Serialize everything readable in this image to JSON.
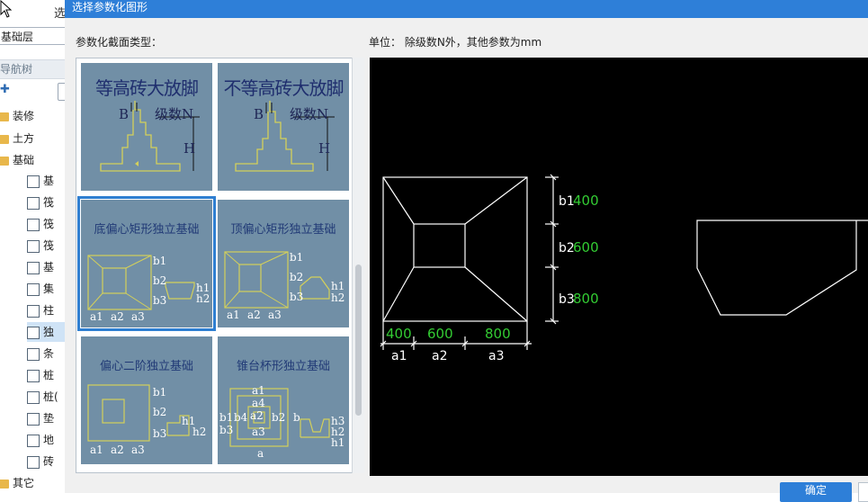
{
  "app": {
    "toolbar_fragment": "选",
    "floor_value": "基础层",
    "nav_title": "导航树",
    "tree": [
      {
        "label": "装修",
        "kind": "folder"
      },
      {
        "label": "土方",
        "kind": "folder"
      },
      {
        "label": "基础",
        "kind": "folder"
      },
      {
        "label": "基",
        "kind": "item",
        "icon": "pencil-icon"
      },
      {
        "label": "筏",
        "kind": "item",
        "icon": "raft-icon"
      },
      {
        "label": "筏",
        "kind": "item",
        "icon": "raft-grid-icon"
      },
      {
        "label": "筏",
        "kind": "item",
        "icon": "raft-opening-icon"
      },
      {
        "label": "基",
        "kind": "item",
        "icon": "beam-icon"
      },
      {
        "label": "集",
        "kind": "item",
        "icon": "sump-icon"
      },
      {
        "label": "柱",
        "kind": "item",
        "icon": "column-pier-icon"
      },
      {
        "label": "独",
        "kind": "item",
        "icon": "isolated-footing-icon"
      },
      {
        "label": "条",
        "kind": "item",
        "icon": "strip-footing-icon"
      },
      {
        "label": "桩",
        "kind": "item",
        "icon": "pile-cap-icon"
      },
      {
        "label": "桩(",
        "kind": "item",
        "icon": "pile-icon"
      },
      {
        "label": "垫",
        "kind": "item",
        "icon": "cushion-icon"
      },
      {
        "label": "地",
        "kind": "item",
        "icon": "ground-beam-icon"
      },
      {
        "label": "砖",
        "kind": "item",
        "icon": "brick-icon"
      },
      {
        "label": "其它",
        "kind": "folder"
      }
    ]
  },
  "dialog": {
    "title": "选择参数化图形",
    "types_label": "参数化截面类型：",
    "units_label": "单位：  除级数N外，其他参数为mm",
    "ok_label": "确定"
  },
  "gallery": [
    {
      "title": "等高砖大放脚",
      "labels": [
        "B",
        "级数N",
        "H"
      ]
    },
    {
      "title": "不等高砖大放脚",
      "labels": [
        "B",
        "级数N",
        "H"
      ]
    },
    {
      "title": "底偏心矩形独立基础",
      "labels": [
        "b1",
        "b2",
        "b3",
        "a1",
        "a2",
        "a3",
        "h1",
        "h2"
      ],
      "selected": true
    },
    {
      "title": "顶偏心矩形独立基础",
      "labels": [
        "b1",
        "b2",
        "b3",
        "a1",
        "a2",
        "a3",
        "h1",
        "h2"
      ]
    },
    {
      "title": "偏心二阶独立基础",
      "labels": [
        "b1",
        "b2",
        "b3",
        "a1",
        "a2",
        "a3",
        "h1",
        "h2"
      ]
    },
    {
      "title": "锥台杯形独立基础",
      "labels": [
        "a1",
        "a4",
        "a2",
        "a3",
        "b1",
        "b4",
        "b2",
        "b",
        "b3",
        "a",
        "h3",
        "h2",
        "h1"
      ]
    }
  ],
  "preview": {
    "b_labels": [
      "b1",
      "b2",
      "b3"
    ],
    "b_values": [
      "400",
      "600",
      "800"
    ],
    "a_labels": [
      "a1",
      "a2",
      "a3"
    ],
    "a_values": [
      "400",
      "600",
      "800"
    ],
    "value_color": "#33cc33",
    "line_color": "#ffffff"
  }
}
